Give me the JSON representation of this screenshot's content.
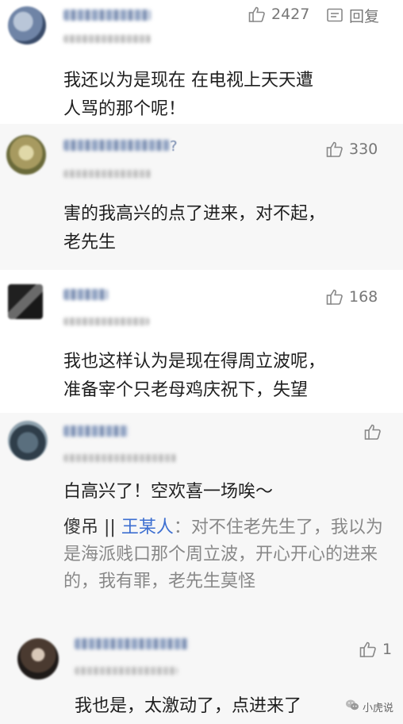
{
  "comments": [
    {
      "likes": "2427",
      "reply_label": "回复",
      "text": "我还以为是现在 在电视上天天遭\n人骂的那个呢！"
    },
    {
      "likes": "330",
      "username_suffix": "?",
      "text": "害的我高兴的点了进来，对不起，\n老先生"
    },
    {
      "likes": "168",
      "text": "我也这样认为是现在得周立波呢，\n准备宰个只老母鸡庆祝下，失望"
    },
    {
      "likes": "",
      "text": "白高兴了！空欢喜一场唉～",
      "quote": {
        "user": "傻吊",
        "separator": "||",
        "name": "王某人",
        "colon": "：",
        "text": "对不住老先生了，我以为是海派贱口那个周立波，开心开心的进来的，我有罪，老先生莫怪"
      }
    },
    {
      "likes": "1",
      "text": "我也是，太激动了，点进来了"
    }
  ],
  "watermark": {
    "label": "小虎说"
  },
  "colors": {
    "link_blue": "#3d6fd1",
    "muted_gray": "#888888",
    "alt_background": "#f7f7f7"
  },
  "icons": [
    "thumbs-up-icon",
    "reply-icon",
    "wechat-icon"
  ]
}
